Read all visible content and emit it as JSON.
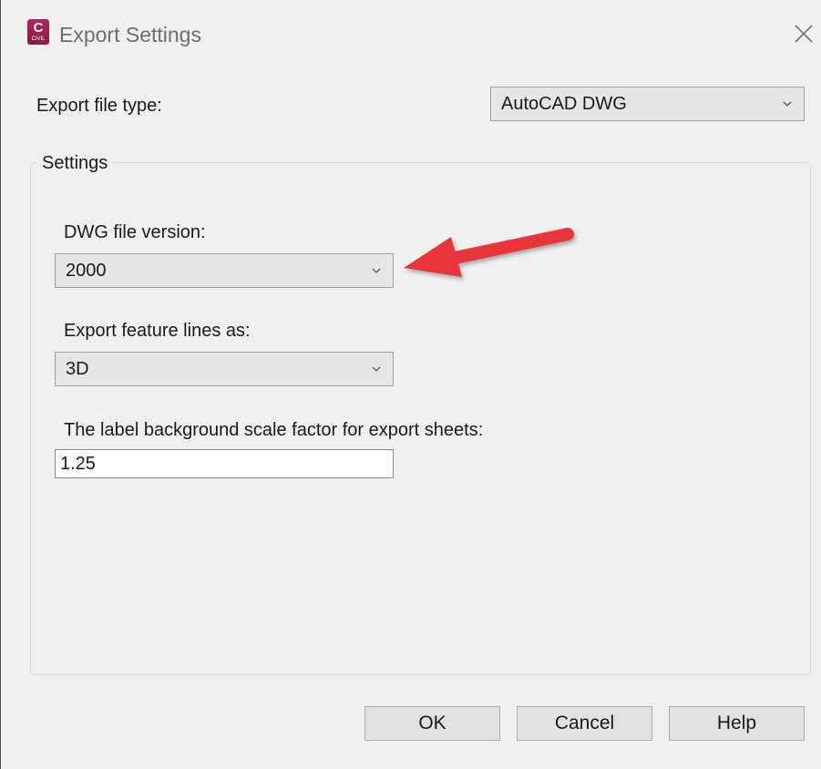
{
  "window": {
    "title": "Export Settings",
    "app_icon_letter": "C",
    "app_icon_sub": "CIVIL"
  },
  "export_type": {
    "label": "Export file type:",
    "selected": "AutoCAD DWG"
  },
  "settings_group": {
    "title": "Settings",
    "dwg_version": {
      "label": "DWG file version:",
      "selected": "2000"
    },
    "feature_lines": {
      "label": "Export feature lines as:",
      "selected": "3D"
    },
    "label_scale": {
      "label": "The label background scale factor for export sheets:",
      "value": "1.25"
    }
  },
  "buttons": {
    "ok": "OK",
    "cancel": "Cancel",
    "help": "Help"
  },
  "colors": {
    "annotation_arrow": "#e8363a",
    "app_icon": "#a8235a"
  },
  "icons": {
    "close": "close-icon",
    "dropdown": "chevron-down-icon",
    "app": "civil-3d-app-icon"
  }
}
